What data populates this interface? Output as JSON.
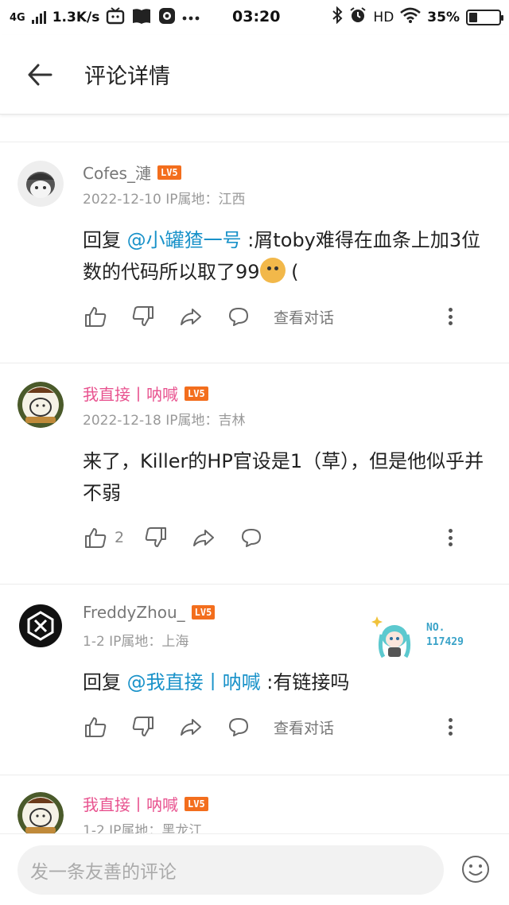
{
  "status_bar": {
    "network": "4G",
    "speed": "1.3K/s",
    "time": "03:20",
    "hd": "HD",
    "battery_percent": "35%",
    "battery_level": 0.35
  },
  "header": {
    "title": "评论详情"
  },
  "comments": [
    {
      "username": "Cofes_漣",
      "level": "LV5",
      "meta": "2022-12-10  IP属地：江西",
      "reply_prefix": "回复 ",
      "mention": "@小罐猹一号",
      "text": " :屑toby难得在血条上加3位数的代码所以取了99",
      "text_tail": " (",
      "view_conversation": "查看对话"
    },
    {
      "username": "我直接丨呐喊",
      "level": "LV5",
      "meta": "2022-12-18  IP属地：吉林",
      "text": "来了，Killer的HP官设是1（草），但是他似乎并不弱",
      "like_count": "2"
    },
    {
      "username": "FreddyZhou_",
      "level": "LV5",
      "meta": "1-2  IP属地：上海",
      "reply_prefix": "回复 ",
      "mention": "@我直接丨呐喊",
      "text": " :有链接吗",
      "view_conversation": "查看对话",
      "badge_label": "NO.",
      "badge_number": "117429"
    },
    {
      "username": "我直接丨呐喊",
      "level": "LV5",
      "meta": "1-2  IP属地：黑龙江"
    }
  ],
  "input": {
    "placeholder": "发一条友善的评论"
  }
}
